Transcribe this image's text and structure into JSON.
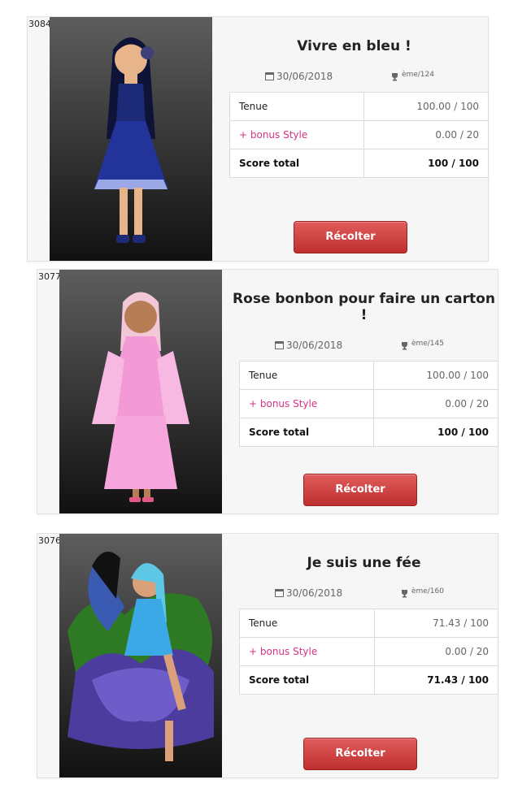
{
  "cards": [
    {
      "id": "3084",
      "title": "Vivre en bleu !",
      "date": "30/06/2018",
      "rank": "ème/124",
      "tenue_label": "Tenue",
      "tenue_value": "100.00 / 100",
      "bonus_label": "+ bonus Style",
      "bonus_value": "0.00 / 20",
      "total_label": "Score total",
      "total_value": "100 / 100",
      "button_label": "Récolter",
      "avatar_theme": "blue-dress-doll"
    },
    {
      "id": "3077",
      "title": "Rose bonbon pour faire un carton !",
      "date": "30/06/2018",
      "rank": "ème/145",
      "tenue_label": "Tenue",
      "tenue_value": "100.00 / 100",
      "bonus_label": "+ bonus Style",
      "bonus_value": "0.00 / 20",
      "total_label": "Score total",
      "total_value": "100 / 100",
      "button_label": "Récolter",
      "avatar_theme": "pink-kimono-doll"
    },
    {
      "id": "3076",
      "title": "Je suis une fée",
      "date": "30/06/2018",
      "rank": "ème/160",
      "tenue_label": "Tenue",
      "tenue_value": "71.43 / 100",
      "bonus_label": "+ bonus Style",
      "bonus_value": "0.00 / 20",
      "total_label": "Score total",
      "total_value": "71.43 / 100",
      "button_label": "Récolter",
      "avatar_theme": "fairy-doll"
    }
  ],
  "icons": {
    "date": "calendar-icon",
    "rank": "trophy-icon"
  },
  "colors": {
    "bonus": "#d63384",
    "button": "#cf3c3c",
    "avatar_bg": "#333333"
  }
}
